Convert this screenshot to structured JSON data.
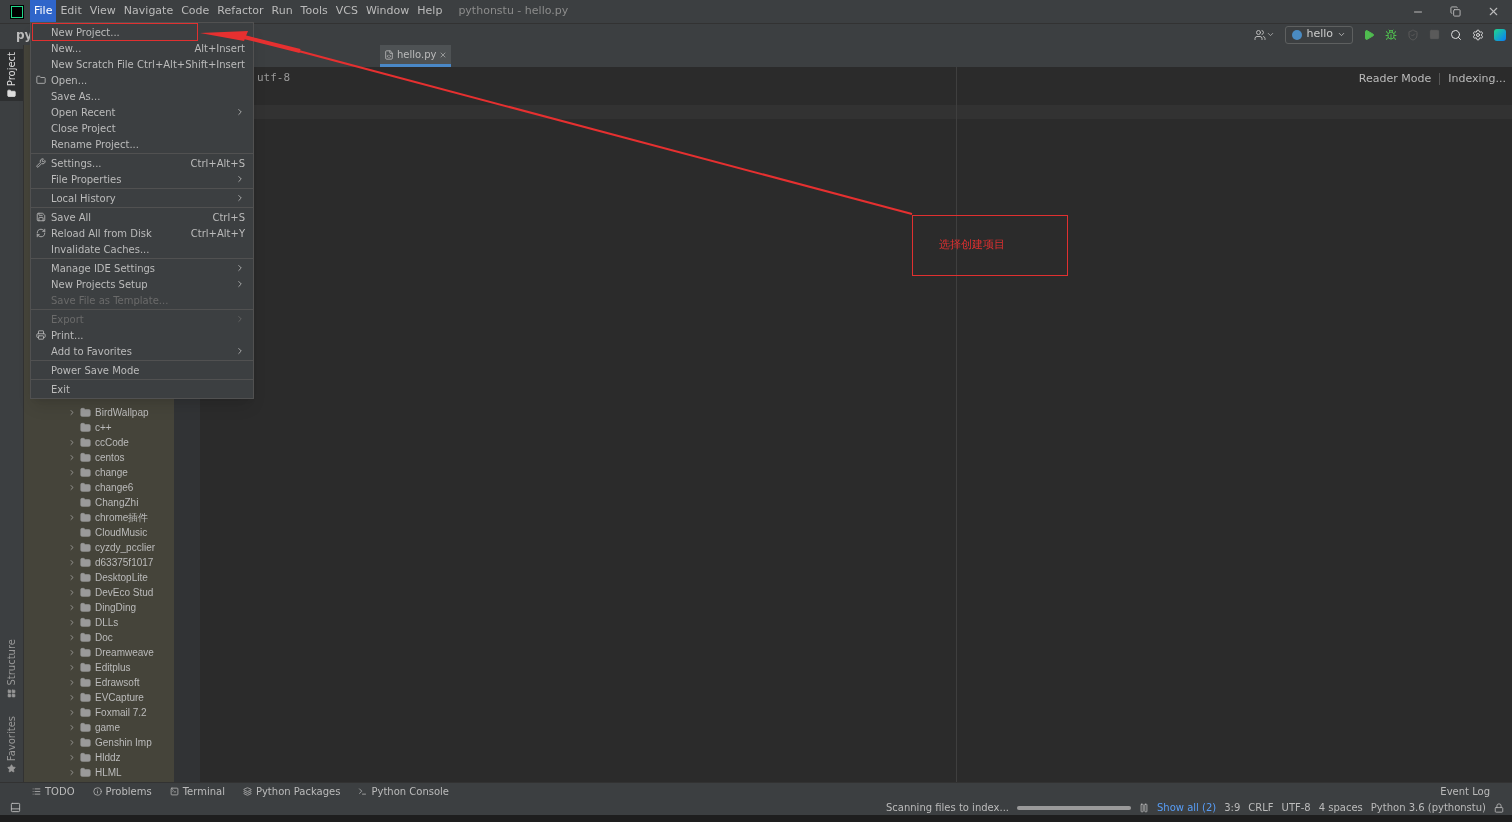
{
  "menu_bar": [
    {
      "label": "File",
      "selected": true
    },
    {
      "label": "Edit",
      "selected": false
    },
    {
      "label": "View",
      "selected": false
    },
    {
      "label": "Navigate",
      "selected": false
    },
    {
      "label": "Code",
      "selected": false
    },
    {
      "label": "Refactor",
      "selected": false
    },
    {
      "label": "Run",
      "selected": false
    },
    {
      "label": "Tools",
      "selected": false
    },
    {
      "label": "VCS",
      "selected": false
    },
    {
      "label": "Window",
      "selected": false
    },
    {
      "label": "Help",
      "selected": false
    }
  ],
  "window": {
    "title": "pythonstu - hello.py"
  },
  "toolbar": {
    "project": "py",
    "run_config": "hello"
  },
  "file_menu": [
    {
      "kind": "item",
      "label": "New Project...",
      "highlighted": true
    },
    {
      "kind": "item",
      "label": "New...",
      "shortcut": "Alt+Insert"
    },
    {
      "kind": "item",
      "label": "New Scratch File",
      "shortcut": "Ctrl+Alt+Shift+Insert"
    },
    {
      "kind": "item",
      "label": "Open..."
    },
    {
      "kind": "item",
      "label": "Save As..."
    },
    {
      "kind": "item",
      "label": "Open Recent",
      "submenu": true
    },
    {
      "kind": "item",
      "label": "Close Project"
    },
    {
      "kind": "item",
      "label": "Rename Project..."
    },
    {
      "kind": "separator"
    },
    {
      "kind": "item",
      "label": "Settings...",
      "shortcut": "Ctrl+Alt+S"
    },
    {
      "kind": "item",
      "label": "File Properties",
      "submenu": true
    },
    {
      "kind": "separator"
    },
    {
      "kind": "item",
      "label": "Local History",
      "submenu": true
    },
    {
      "kind": "separator"
    },
    {
      "kind": "item",
      "label": "Save All",
      "shortcut": "Ctrl+S"
    },
    {
      "kind": "item",
      "label": "Reload All from Disk",
      "shortcut": "Ctrl+Alt+Y"
    },
    {
      "kind": "item",
      "label": "Invalidate Caches..."
    },
    {
      "kind": "separator"
    },
    {
      "kind": "item",
      "label": "Manage IDE Settings",
      "submenu": true
    },
    {
      "kind": "item",
      "label": "New Projects Setup",
      "submenu": true
    },
    {
      "kind": "item",
      "label": "Save File as Template...",
      "disabled": true
    },
    {
      "kind": "separator"
    },
    {
      "kind": "item",
      "label": "Export",
      "submenu": true,
      "disabled": true
    },
    {
      "kind": "item",
      "label": "Print..."
    },
    {
      "kind": "item",
      "label": "Add to Favorites",
      "submenu": true
    },
    {
      "kind": "separator"
    },
    {
      "kind": "item",
      "label": "Power Save Mode"
    },
    {
      "kind": "separator"
    },
    {
      "kind": "item",
      "label": "Exit"
    }
  ],
  "side_tabs": [
    {
      "label": "Project",
      "selected": true
    },
    {
      "label": "Structure",
      "selected": false
    },
    {
      "label": "Favorites",
      "selected": false
    }
  ],
  "project_tree": [
    {
      "label": "BirdWallpap",
      "expandable": true
    },
    {
      "label": "c++",
      "expandable": false
    },
    {
      "label": "ccCode",
      "expandable": true
    },
    {
      "label": "centos",
      "expandable": true
    },
    {
      "label": "change",
      "expandable": true
    },
    {
      "label": "change6",
      "expandable": true
    },
    {
      "label": "ChangZhi",
      "expandable": false
    },
    {
      "label": "chrome插件",
      "expandable": true
    },
    {
      "label": "CloudMusic",
      "expandable": false
    },
    {
      "label": "cyzdy_pcclier",
      "expandable": true
    },
    {
      "label": "d63375f1017",
      "expandable": true
    },
    {
      "label": "DesktopLite",
      "expandable": true
    },
    {
      "label": "DevEco Stud",
      "expandable": true
    },
    {
      "label": "DingDing",
      "expandable": true
    },
    {
      "label": "DLLs",
      "expandable": true
    },
    {
      "label": "Doc",
      "expandable": true
    },
    {
      "label": "Dreamweave",
      "expandable": true
    },
    {
      "label": "Editplus",
      "expandable": true
    },
    {
      "label": "Edrawsoft",
      "expandable": true
    },
    {
      "label": "EVCapture",
      "expandable": true
    },
    {
      "label": "Foxmail 7.2",
      "expandable": true
    },
    {
      "label": "game",
      "expandable": true
    },
    {
      "label": "Genshin Imp",
      "expandable": true
    },
    {
      "label": "Hlddz",
      "expandable": true
    },
    {
      "label": "HLML",
      "expandable": true
    }
  ],
  "editor": {
    "tab": "hello.py",
    "line": "utf-8",
    "reader_mode": "Reader Mode",
    "indexing": "Indexing..."
  },
  "annotation": {
    "text": "选择创建项目"
  },
  "tool_windows": [
    {
      "label": "TODO"
    },
    {
      "label": "Problems"
    },
    {
      "label": "Terminal"
    },
    {
      "label": "Python Packages"
    },
    {
      "label": "Python Console"
    }
  ],
  "event_log": "Event Log",
  "status_bar": {
    "task": "Scanning files to index...",
    "progress": {
      "level": 1.0
    },
    "show_all": "Show all (2)",
    "items": [
      "3:9",
      "CRLF",
      "UTF-8",
      "4 spaces",
      "Python 3.6 (pythonstu)"
    ]
  }
}
